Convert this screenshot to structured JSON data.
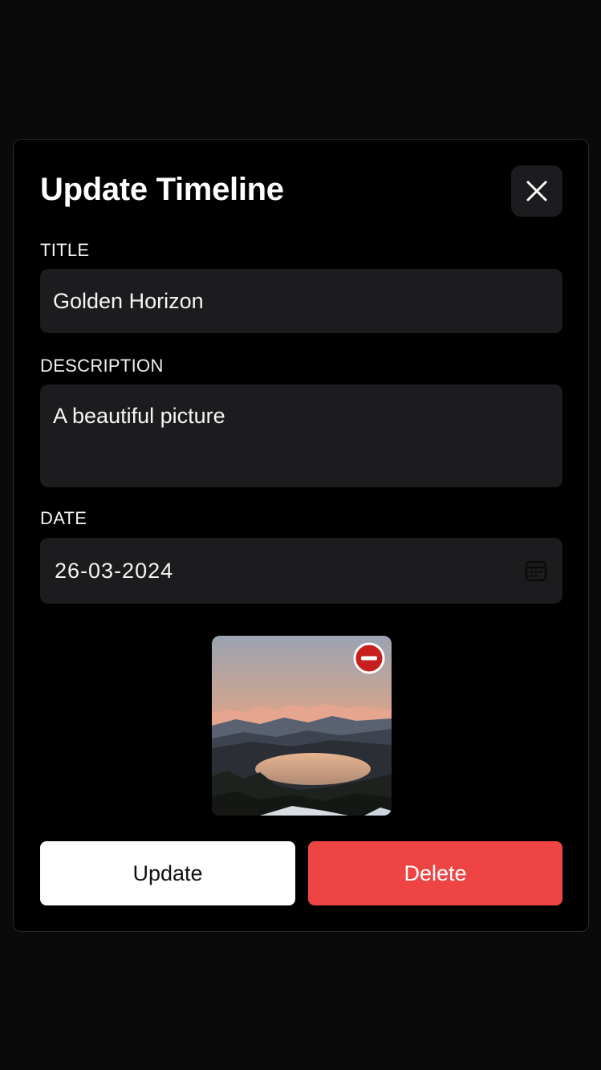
{
  "modal": {
    "title": "Update Timeline"
  },
  "form": {
    "title_label": "TITLE",
    "title_value": "Golden Horizon",
    "description_label": "DESCRIPTION",
    "description_value": "A beautiful picture",
    "date_label": "DATE",
    "date_value": "26-03-2024"
  },
  "actions": {
    "update_label": "Update",
    "delete_label": "Delete"
  },
  "colors": {
    "background": "#0a0a0a",
    "modal": "#000000",
    "field": "#1c1c1f",
    "delete": "#ef4444",
    "remove_icon": "#c81e1e"
  },
  "icons": {
    "close": "close-icon",
    "calendar": "calendar-icon",
    "remove_image": "remove-image-icon"
  }
}
